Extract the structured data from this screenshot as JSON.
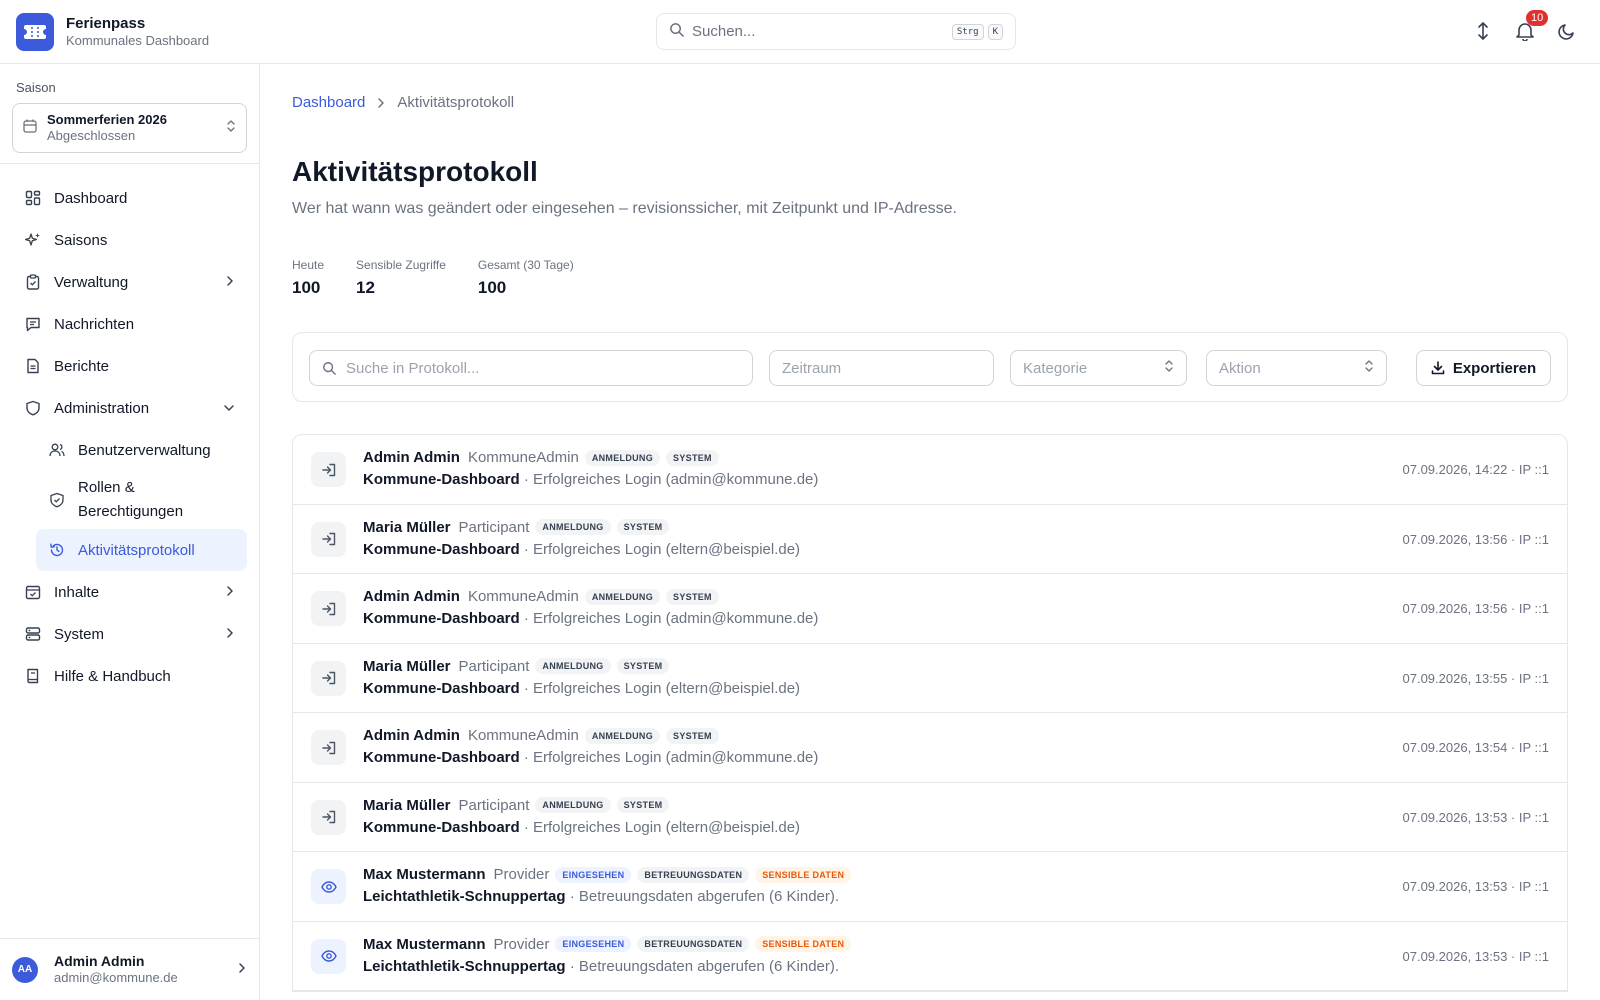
{
  "brand": {
    "title": "Ferienpass",
    "subtitle": "Kommunales Dashboard"
  },
  "header": {
    "search_placeholder": "Suchen...",
    "shortcut_keys": [
      "Strg",
      "K"
    ],
    "notification_count": "10"
  },
  "sidebar": {
    "season_label": "Saison",
    "season_name": "Sommerferien 2026",
    "season_status": "Abgeschlossen",
    "nav": {
      "dashboard": "Dashboard",
      "saisons": "Saisons",
      "verwaltung": "Verwaltung",
      "nachrichten": "Nachrichten",
      "berichte": "Berichte",
      "administration": "Administration",
      "benutzerverwaltung": "Benutzerverwaltung",
      "rollen": "Rollen & Berechtigungen",
      "aktivitaetsprotokoll": "Aktivitätsprotokoll",
      "inhalte": "Inhalte",
      "system": "System",
      "hilfe": "Hilfe & Handbuch"
    },
    "user": {
      "initials": "AA",
      "name": "Admin Admin",
      "email": "admin@kommune.de"
    }
  },
  "breadcrumb": {
    "home": "Dashboard",
    "current": "Aktivitätsprotokoll"
  },
  "page": {
    "title": "Aktivitätsprotokoll",
    "subtitle": "Wer hat wann was geändert oder eingesehen – revisionssicher, mit Zeitpunkt und IP-Adresse."
  },
  "stats": [
    {
      "label": "Heute",
      "value": "100"
    },
    {
      "label": "Sensible Zugriffe",
      "value": "12"
    },
    {
      "label": "Gesamt (30 Tage)",
      "value": "100"
    }
  ],
  "filters": {
    "search_placeholder": "Suche in Protokoll...",
    "zeitraum_placeholder": "Zeitraum",
    "kategorie_placeholder": "Kategorie",
    "aktion_placeholder": "Aktion",
    "export_label": "Exportieren"
  },
  "logs": [
    {
      "icon": "login-icon",
      "user": "Admin Admin",
      "role": "KommuneAdmin",
      "badges": [
        {
          "text": "ANMELDUNG",
          "tone": "gray"
        },
        {
          "text": "SYSTEM",
          "tone": "gray"
        }
      ],
      "target": "Kommune-Dashboard",
      "desc": " · Erfolgreiches Login (admin@kommune.de)",
      "meta": "07.09.2026, 14:22 · IP ::1"
    },
    {
      "icon": "login-icon",
      "user": "Maria Müller",
      "role": "Participant",
      "badges": [
        {
          "text": "ANMELDUNG",
          "tone": "gray"
        },
        {
          "text": "SYSTEM",
          "tone": "gray"
        }
      ],
      "target": "Kommune-Dashboard",
      "desc": " · Erfolgreiches Login (eltern@beispiel.de)",
      "meta": "07.09.2026, 13:56 · IP ::1"
    },
    {
      "icon": "login-icon",
      "user": "Admin Admin",
      "role": "KommuneAdmin",
      "badges": [
        {
          "text": "ANMELDUNG",
          "tone": "gray"
        },
        {
          "text": "SYSTEM",
          "tone": "gray"
        }
      ],
      "target": "Kommune-Dashboard",
      "desc": " · Erfolgreiches Login (admin@kommune.de)",
      "meta": "07.09.2026, 13:56 · IP ::1"
    },
    {
      "icon": "login-icon",
      "user": "Maria Müller",
      "role": "Participant",
      "badges": [
        {
          "text": "ANMELDUNG",
          "tone": "gray"
        },
        {
          "text": "SYSTEM",
          "tone": "gray"
        }
      ],
      "target": "Kommune-Dashboard",
      "desc": " · Erfolgreiches Login (eltern@beispiel.de)",
      "meta": "07.09.2026, 13:55 · IP ::1"
    },
    {
      "icon": "login-icon",
      "user": "Admin Admin",
      "role": "KommuneAdmin",
      "badges": [
        {
          "text": "ANMELDUNG",
          "tone": "gray"
        },
        {
          "text": "SYSTEM",
          "tone": "gray"
        }
      ],
      "target": "Kommune-Dashboard",
      "desc": " · Erfolgreiches Login (admin@kommune.de)",
      "meta": "07.09.2026, 13:54 · IP ::1"
    },
    {
      "icon": "login-icon",
      "user": "Maria Müller",
      "role": "Participant",
      "badges": [
        {
          "text": "ANMELDUNG",
          "tone": "gray"
        },
        {
          "text": "SYSTEM",
          "tone": "gray"
        }
      ],
      "target": "Kommune-Dashboard",
      "desc": " · Erfolgreiches Login (eltern@beispiel.de)",
      "meta": "07.09.2026, 13:53 · IP ::1"
    },
    {
      "icon": "eye-icon",
      "user": "Max Mustermann",
      "role": "Provider",
      "badges": [
        {
          "text": "EINGESEHEN",
          "tone": "blue"
        },
        {
          "text": "BETREUUNGSDATEN",
          "tone": "gray"
        },
        {
          "text": "SENSIBLE DATEN",
          "tone": "orange"
        }
      ],
      "target": "Leichtathletik-Schnuppertag",
      "desc": " · Betreuungsdaten abgerufen (6 Kinder).",
      "meta": "07.09.2026, 13:53 · IP ::1"
    },
    {
      "icon": "eye-icon",
      "user": "Max Mustermann",
      "role": "Provider",
      "badges": [
        {
          "text": "EINGESEHEN",
          "tone": "blue"
        },
        {
          "text": "BETREUUNGSDATEN",
          "tone": "gray"
        },
        {
          "text": "SENSIBLE DATEN",
          "tone": "orange"
        }
      ],
      "target": "Leichtathletik-Schnuppertag",
      "desc": " · Betreuungsdaten abgerufen (6 Kinder).",
      "meta": "07.09.2026, 13:53 · IP ::1"
    }
  ],
  "colors": {
    "accent": "#3b5bdb",
    "badge_red": "#e03131",
    "sensitive": "#e8590c"
  }
}
